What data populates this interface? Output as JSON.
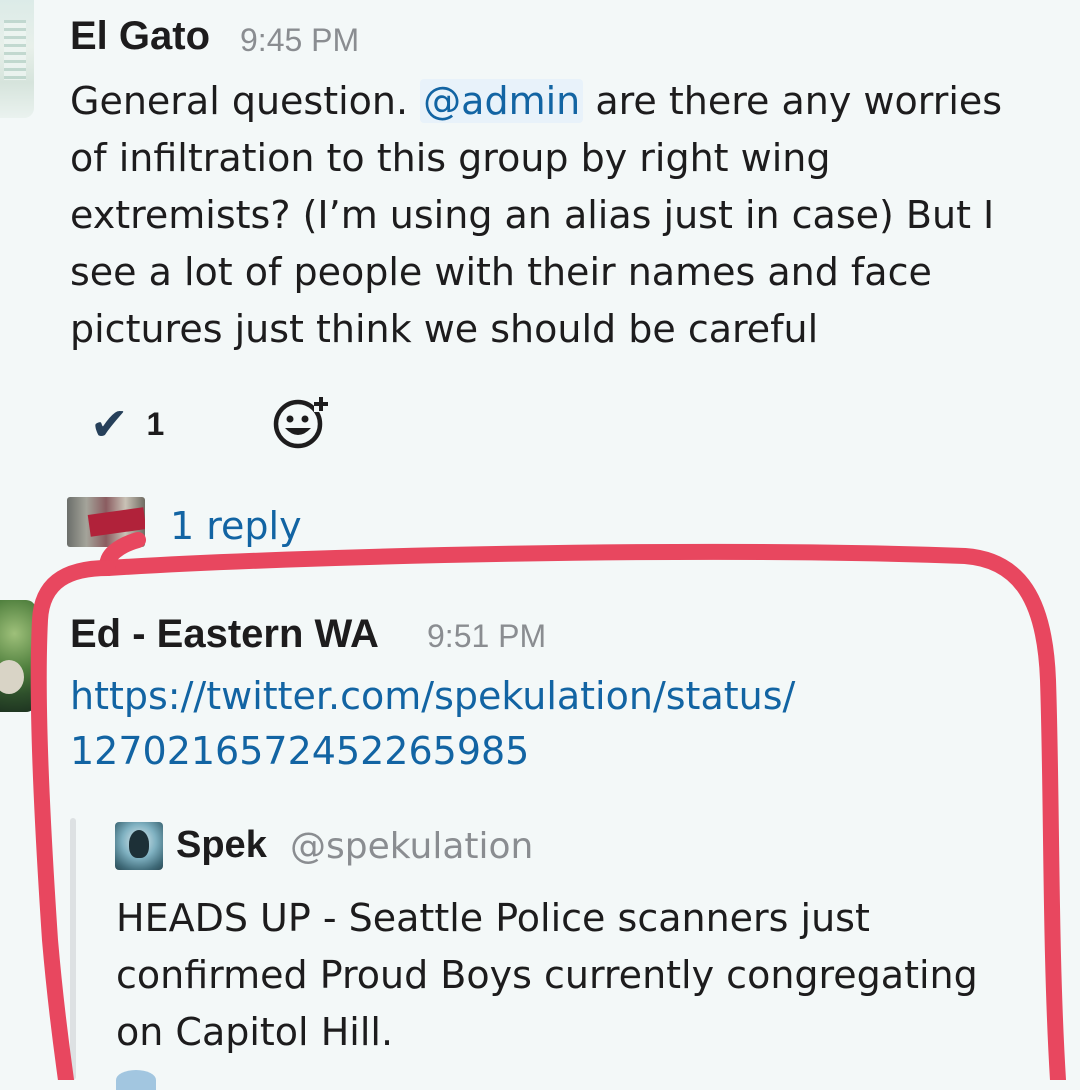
{
  "messages": [
    {
      "sender": "El Gato",
      "time": "9:45 PM",
      "text_before_mention": "General question. ",
      "mention": "@admin",
      "text_after_mention": " are there any worries",
      "lines": [
        "of infiltration to this group by right wing",
        "extremists? (I’m using an alias just in case) But I",
        "see a lot of people with their names and face",
        "pictures just think we should be careful"
      ],
      "reaction": {
        "emoji": "✔",
        "count": "1"
      },
      "add_reaction_icon": "add-reaction-icon",
      "reply_count": "1 reply"
    },
    {
      "sender": "Ed - Eastern WA",
      "time": "9:51 PM",
      "link_lines": [
        "https://twitter.com/spekulation/status/",
        "1270216572452265985"
      ],
      "attachment": {
        "author": "Spek",
        "handle": "@spekulation",
        "lines": [
          "HEADS UP - Seattle Police scanners just",
          "confirmed Proud Boys currently congregating",
          "on Capitol Hill."
        ]
      }
    }
  ],
  "colors": {
    "background": "#f3f8f8",
    "link": "#1264a3",
    "annotation": "#e8475f"
  }
}
